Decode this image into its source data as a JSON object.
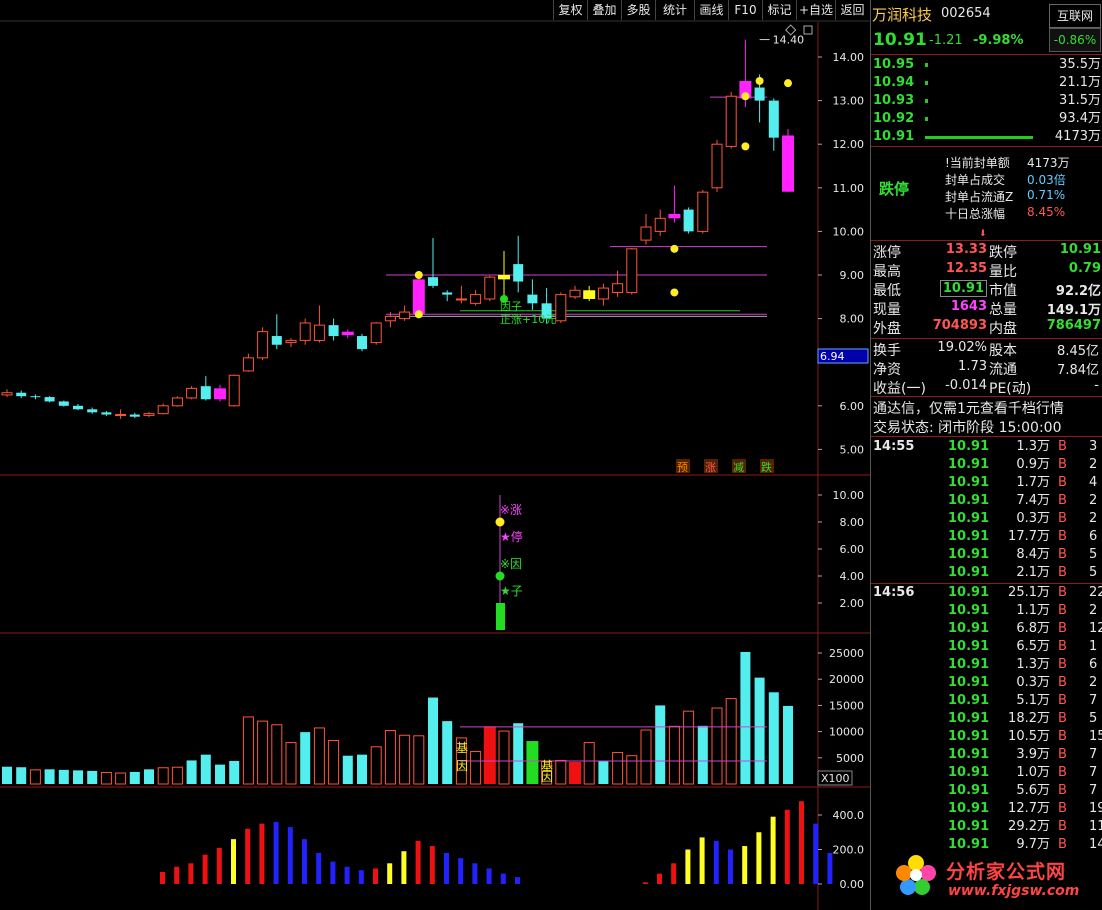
{
  "toolbar": {
    "buttons": [
      "复权",
      "叠加",
      "多股",
      "统计",
      "画线",
      "F10",
      "标记",
      "+自选",
      "返回"
    ]
  },
  "main_chart": {
    "y_ticks": [
      "14.00",
      "13.00",
      "12.00",
      "11.00",
      "10.00",
      "9.00",
      "8.00",
      "6.00",
      "5.00"
    ],
    "current_marker": "6.94",
    "high_label": "14.40",
    "legend": [
      {
        "text": "预",
        "color": "#ff8800"
      },
      {
        "text": "涨",
        "color": "#ff5555"
      },
      {
        "text": "减",
        "color": "#33dd33"
      },
      {
        "text": "跌",
        "color": "#33dd33"
      }
    ],
    "annotations": [
      "因子",
      "正涨+10元"
    ],
    "candles": [
      {
        "o": 6.25,
        "c": 6.3,
        "h": 6.38,
        "l": 6.2
      },
      {
        "o": 6.3,
        "c": 6.22,
        "h": 6.35,
        "l": 6.18
      },
      {
        "o": 6.22,
        "c": 6.2,
        "h": 6.26,
        "l": 6.15
      },
      {
        "o": 6.2,
        "c": 6.1,
        "h": 6.22,
        "l": 6.08
      },
      {
        "o": 6.1,
        "c": 6.0,
        "h": 6.12,
        "l": 5.98
      },
      {
        "o": 6.0,
        "c": 5.92,
        "h": 6.04,
        "l": 5.9
      },
      {
        "o": 5.92,
        "c": 5.85,
        "h": 5.96,
        "l": 5.82
      },
      {
        "o": 5.85,
        "c": 5.8,
        "h": 5.88,
        "l": 5.77
      },
      {
        "o": 5.8,
        "c": 5.8,
        "h": 5.92,
        "l": 5.7
      },
      {
        "o": 5.8,
        "c": 5.75,
        "h": 5.84,
        "l": 5.72
      },
      {
        "o": 5.78,
        "c": 5.82,
        "h": 5.86,
        "l": 5.74
      },
      {
        "o": 5.82,
        "c": 6.0,
        "h": 6.05,
        "l": 5.8
      },
      {
        "o": 6.0,
        "c": 6.18,
        "h": 6.22,
        "l": 5.98
      },
      {
        "o": 6.18,
        "c": 6.4,
        "h": 6.45,
        "l": 6.15
      },
      {
        "o": 6.45,
        "c": 6.15,
        "h": 6.68,
        "l": 6.12
      },
      {
        "o": 6.15,
        "c": 6.4,
        "h": 6.48,
        "l": 6.1
      },
      {
        "o": 6.0,
        "c": 6.7,
        "h": 6.72,
        "l": 5.98
      },
      {
        "o": 6.8,
        "c": 7.1,
        "h": 7.2,
        "l": 6.78
      },
      {
        "o": 7.1,
        "c": 7.7,
        "h": 7.8,
        "l": 7.05
      },
      {
        "o": 7.6,
        "c": 7.4,
        "h": 8.1,
        "l": 7.3
      },
      {
        "o": 7.45,
        "c": 7.5,
        "h": 7.55,
        "l": 7.35
      },
      {
        "o": 7.5,
        "c": 7.9,
        "h": 8.0,
        "l": 7.4
      },
      {
        "o": 7.5,
        "c": 7.85,
        "h": 8.3,
        "l": 7.45
      },
      {
        "o": 7.85,
        "c": 7.6,
        "h": 8.0,
        "l": 7.5
      },
      {
        "o": 7.7,
        "c": 7.62,
        "h": 7.75,
        "l": 7.55
      },
      {
        "o": 7.6,
        "c": 7.3,
        "h": 7.65,
        "l": 7.25
      },
      {
        "o": 7.45,
        "c": 7.9,
        "h": 7.92,
        "l": 7.4
      },
      {
        "o": 7.95,
        "c": 8.05,
        "h": 8.15,
        "l": 7.8
      },
      {
        "o": 8.0,
        "c": 8.15,
        "h": 8.3,
        "l": 7.95
      },
      {
        "o": 8.1,
        "c": 8.9,
        "h": 8.95,
        "l": 8.0
      },
      {
        "o": 8.95,
        "c": 8.75,
        "h": 9.85,
        "l": 8.7
      },
      {
        "o": 8.6,
        "c": 8.55,
        "h": 8.65,
        "l": 8.4
      },
      {
        "o": 8.45,
        "c": 8.45,
        "h": 8.75,
        "l": 8.35
      },
      {
        "o": 8.35,
        "c": 8.55,
        "h": 8.65,
        "l": 8.3
      },
      {
        "o": 8.45,
        "c": 8.95,
        "h": 8.98,
        "l": 8.4
      },
      {
        "o": 9.0,
        "c": 8.9,
        "h": 9.55,
        "l": 8.5
      },
      {
        "o": 9.25,
        "c": 8.85,
        "h": 9.9,
        "l": 8.6
      },
      {
        "o": 8.55,
        "c": 8.35,
        "h": 8.9,
        "l": 8.2
      },
      {
        "o": 8.35,
        "c": 8.0,
        "h": 8.7,
        "l": 7.9
      },
      {
        "o": 7.95,
        "c": 8.55,
        "h": 8.6,
        "l": 7.9
      },
      {
        "o": 8.5,
        "c": 8.65,
        "h": 8.75,
        "l": 8.45
      },
      {
        "o": 8.65,
        "c": 8.45,
        "h": 8.75,
        "l": 8.4
      },
      {
        "o": 8.45,
        "c": 8.7,
        "h": 8.8,
        "l": 8.3
      },
      {
        "o": 8.6,
        "c": 8.8,
        "h": 9.1,
        "l": 8.5
      },
      {
        "o": 8.6,
        "c": 9.6,
        "h": 9.62,
        "l": 8.55
      },
      {
        "o": 9.8,
        "c": 10.1,
        "h": 10.4,
        "l": 9.7
      },
      {
        "o": 10.0,
        "c": 10.3,
        "h": 10.5,
        "l": 9.9
      },
      {
        "o": 10.3,
        "c": 10.4,
        "h": 11.05,
        "l": 10.2
      },
      {
        "o": 10.5,
        "c": 10.0,
        "h": 10.55,
        "l": 9.95
      },
      {
        "o": 10.0,
        "c": 10.9,
        "h": 10.95,
        "l": 9.95
      },
      {
        "o": 11.0,
        "c": 12.0,
        "h": 12.1,
        "l": 10.9
      },
      {
        "o": 11.95,
        "c": 13.1,
        "h": 13.2,
        "l": 11.9
      },
      {
        "o": 13.45,
        "c": 13.05,
        "h": 14.4,
        "l": 12.85
      },
      {
        "o": 13.3,
        "c": 13.0,
        "h": 13.6,
        "l": 12.5
      },
      {
        "o": 13.0,
        "c": 12.15,
        "h": 13.05,
        "l": 11.85
      },
      {
        "o": 12.2,
        "c": 10.91,
        "h": 12.35,
        "l": 10.91
      }
    ],
    "highlight_candles": [
      {
        "i": 15,
        "color": "#ff22ff"
      },
      {
        "i": 24,
        "color": "#ff22ff"
      },
      {
        "i": 29,
        "color": "#ff22ff"
      },
      {
        "i": 35,
        "color": "#ffff22"
      },
      {
        "i": 41,
        "color": "#ffff22"
      },
      {
        "i": 47,
        "color": "#ff22ff"
      },
      {
        "i": 52,
        "color": "#ff22ff"
      },
      {
        "i": 55,
        "color": "#ff22ff"
      }
    ]
  },
  "gene_panel": {
    "y_ticks": [
      "10.00",
      "8.00",
      "6.00",
      "4.00",
      "2.00"
    ],
    "labels": [
      {
        "text": "※涨",
        "color": "#ff44ff"
      },
      {
        "text": "★停",
        "color": "#ff44ff"
      },
      {
        "text": "※因",
        "color": "#33dd33"
      },
      {
        "text": "★子",
        "color": "#33dd33"
      }
    ]
  },
  "volume_panel": {
    "y_ticks": [
      "25000",
      "20000",
      "15000",
      "10000",
      "5000"
    ],
    "unit": "X100",
    "tags": [
      "基",
      "因",
      "基",
      "因"
    ],
    "bars": [
      3300,
      3200,
      2700,
      2800,
      2700,
      2600,
      2500,
      2200,
      2100,
      2300,
      2800,
      3100,
      3200,
      4500,
      5600,
      3700,
      4400,
      12800,
      12000,
      11300,
      7900,
      9900,
      10700,
      8300,
      5400,
      5600,
      7100,
      10200,
      9300,
      9200,
      16500,
      12000,
      8800,
      6200,
      11000,
      10100,
      11600,
      8200,
      4400,
      4500,
      4200,
      7900,
      4400,
      6000,
      5400,
      10300,
      15000,
      11000,
      13900,
      11100,
      14500,
      16300,
      25200,
      20300,
      17500,
      14900
    ],
    "bar_colors": [
      "c",
      "c",
      "r",
      "c",
      "c",
      "c",
      "c",
      "r",
      "r",
      "c",
      "c",
      "r",
      "r",
      "c",
      "c",
      "c",
      "c",
      "r",
      "r",
      "r",
      "r",
      "c",
      "r",
      "r",
      "c",
      "c",
      "r",
      "r",
      "r",
      "r",
      "c",
      "c",
      "r",
      "r",
      "x",
      "r",
      "c",
      "g",
      "r",
      "r",
      "x",
      "r",
      "c",
      "r",
      "r",
      "r",
      "c",
      "r",
      "r",
      "c",
      "r",
      "r",
      "c",
      "c",
      "c",
      "c"
    ]
  },
  "macd_panel": {
    "y_ticks": [
      "400.0",
      "200.0",
      "0.00"
    ],
    "bars": [
      {
        "v": 70,
        "c": "#ee1111"
      },
      {
        "v": 100,
        "c": "#ee1111"
      },
      {
        "v": 120,
        "c": "#ee1111"
      },
      {
        "v": 170,
        "c": "#ee1111"
      },
      {
        "v": 210,
        "c": "#ee1111"
      },
      {
        "v": 260,
        "c": "#ffff22"
      },
      {
        "v": 320,
        "c": "#ee1111"
      },
      {
        "v": 350,
        "c": "#ee1111"
      },
      {
        "v": 360,
        "c": "#2222ff"
      },
      {
        "v": 330,
        "c": "#2222ff"
      },
      {
        "v": 260,
        "c": "#2222ff"
      },
      {
        "v": 180,
        "c": "#2222ff"
      },
      {
        "v": 130,
        "c": "#2222ff"
      },
      {
        "v": 100,
        "c": "#2222ff"
      },
      {
        "v": 80,
        "c": "#2222ff"
      },
      {
        "v": 90,
        "c": "#ee1111"
      },
      {
        "v": 120,
        "c": "#ffff22"
      },
      {
        "v": 190,
        "c": "#ffff22"
      },
      {
        "v": 250,
        "c": "#ee1111"
      },
      {
        "v": 220,
        "c": "#ee1111"
      },
      {
        "v": 180,
        "c": "#2222ff"
      },
      {
        "v": 150,
        "c": "#2222ff"
      },
      {
        "v": 120,
        "c": "#2222ff"
      },
      {
        "v": 90,
        "c": "#2222ff"
      },
      {
        "v": 60,
        "c": "#2222ff"
      },
      {
        "v": 40,
        "c": "#2222ff"
      },
      {
        "v": 0,
        "c": "#000"
      },
      {
        "v": 0,
        "c": "#000"
      },
      {
        "v": 0,
        "c": "#000"
      },
      {
        "v": 0,
        "c": "#000"
      },
      {
        "v": 0,
        "c": "#000"
      },
      {
        "v": 0,
        "c": "#000"
      },
      {
        "v": 0,
        "c": "#000"
      },
      {
        "v": 0,
        "c": "#000"
      },
      {
        "v": 10,
        "c": "#ee1111"
      },
      {
        "v": 60,
        "c": "#ee1111"
      },
      {
        "v": 120,
        "c": "#ee1111"
      },
      {
        "v": 200,
        "c": "#ffff22"
      },
      {
        "v": 270,
        "c": "#ffff22"
      },
      {
        "v": 250,
        "c": "#2222ff"
      },
      {
        "v": 200,
        "c": "#2222ff"
      },
      {
        "v": 220,
        "c": "#ffff22"
      },
      {
        "v": 300,
        "c": "#ffff22"
      },
      {
        "v": 390,
        "c": "#ffff22"
      },
      {
        "v": 430,
        "c": "#ee1111"
      },
      {
        "v": 480,
        "c": "#ee1111"
      },
      {
        "v": 350,
        "c": "#2222ff"
      },
      {
        "v": 180,
        "c": "#2222ff"
      }
    ]
  },
  "quote": {
    "name": "万润科技",
    "code": "002654",
    "sector_btn": "互联网",
    "price": "10.91",
    "change": "-1.21",
    "pct": "-9.98%",
    "sector_pct": "-0.86%",
    "bids": [
      {
        "p": "10.95",
        "v": "35.5万",
        "bar": 0
      },
      {
        "p": "10.94",
        "v": "21.1万",
        "bar": 0
      },
      {
        "p": "10.93",
        "v": "31.5万",
        "bar": 0
      },
      {
        "p": "10.92",
        "v": "93.4万",
        "bar": 0
      },
      {
        "p": "10.91",
        "v": "4173万",
        "bar": 1
      }
    ],
    "limit_badge": "跌停",
    "seal_info": [
      {
        "k": "!当前封单额",
        "v": "4173万",
        "vc": "#e8e8e8"
      },
      {
        "k": "封单占成交",
        "v": "0.03倍",
        "vc": "#66ccff"
      },
      {
        "k": "封单占流通Z",
        "v": "0.71%",
        "vc": "#66ccff"
      },
      {
        "k": "十日总涨幅",
        "v": "8.45%",
        "vc": "#ff5555"
      }
    ],
    "stats": [
      {
        "k1": "涨停",
        "v1": "13.33",
        "c1": "#ff5555",
        "k2": "跌停",
        "v2": "10.91",
        "c2": "#33dd33"
      },
      {
        "k1": "最高",
        "v1": "12.35",
        "c1": "#ff5555",
        "k2": "量比",
        "v2": "0.79",
        "c2": "#33dd33"
      },
      {
        "k1": "最低",
        "v1": "10.91",
        "c1": "#33dd33",
        "k2": "市值",
        "v2": "92.2亿",
        "c2": "#e8e8e8"
      },
      {
        "k1": "现量",
        "v1": "1643",
        "c1": "#ff44ff",
        "k2": "总量",
        "v2": "149.1万",
        "c2": "#e8e8e8"
      },
      {
        "k1": "外盘",
        "v1": "704893",
        "c1": "#ff5555",
        "k2": "内盘",
        "v2": "786497",
        "c2": "#33dd33"
      }
    ],
    "stats2": [
      {
        "k1": "换手",
        "v1": "19.02%",
        "k2": "股本",
        "v2": "8.45亿"
      },
      {
        "k1": "净资",
        "v1": "1.73",
        "k2": "流通",
        "v2": "7.84亿"
      },
      {
        "k1": "收益(一)",
        "v1": "-0.014",
        "k2": "PE(动)",
        "v2": "-"
      }
    ],
    "promo": "通达信，仅需1元查看千档行情",
    "trade_state": "交易状态: 闭市阶段 15:00:00"
  },
  "ticks": {
    "groups": [
      {
        "time": "14:55",
        "rows": [
          [
            "10.91",
            "1.3万",
            "B",
            "3"
          ],
          [
            "10.91",
            "0.9万",
            "B",
            "2"
          ],
          [
            "10.91",
            "1.7万",
            "B",
            "4"
          ],
          [
            "10.91",
            "7.4万",
            "B",
            "2"
          ],
          [
            "10.91",
            "0.3万",
            "B",
            "2"
          ],
          [
            "10.91",
            "17.7万",
            "B",
            "6"
          ],
          [
            "10.91",
            "8.4万",
            "B",
            "5"
          ],
          [
            "10.91",
            "2.1万",
            "B",
            "5"
          ]
        ]
      },
      {
        "time": "14:56",
        "rows": [
          [
            "10.91",
            "25.1万",
            "B",
            "22"
          ],
          [
            "10.91",
            "1.1万",
            "B",
            "2"
          ],
          [
            "10.91",
            "6.8万",
            "B",
            "12"
          ],
          [
            "10.91",
            "6.5万",
            "B",
            "1"
          ],
          [
            "10.91",
            "1.3万",
            "B",
            "6"
          ],
          [
            "10.91",
            "0.3万",
            "B",
            "2"
          ],
          [
            "10.91",
            "5.1万",
            "B",
            "7"
          ],
          [
            "10.91",
            "18.2万",
            "B",
            "5"
          ],
          [
            "10.91",
            "10.5万",
            "B",
            "15"
          ],
          [
            "10.91",
            "3.9万",
            "B",
            "7"
          ],
          [
            "10.91",
            "1.0万",
            "B",
            "7"
          ],
          [
            "10.91",
            "5.6万",
            "B",
            "7"
          ],
          [
            "10.91",
            "12.7万",
            "B",
            "19"
          ],
          [
            "10.91",
            "29.2万",
            "B",
            "11"
          ],
          [
            "10.91",
            "9.7万",
            "B",
            "14"
          ]
        ]
      }
    ]
  },
  "watermark": {
    "title": "分析家公式网",
    "url": "www.fxjgsw.com"
  }
}
